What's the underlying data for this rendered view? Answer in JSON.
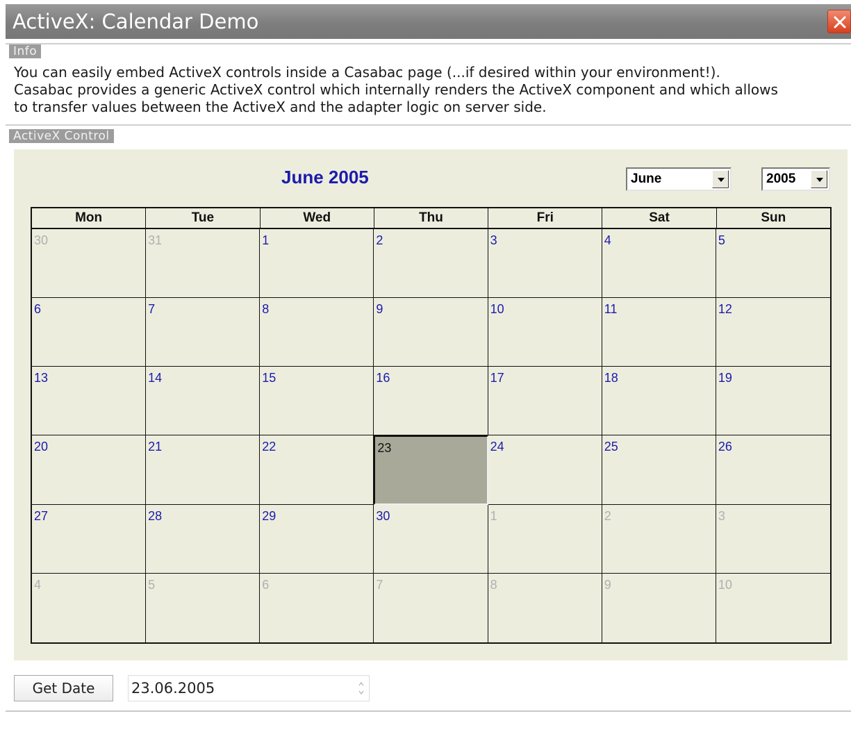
{
  "window": {
    "title": "ActiveX: Calendar Demo"
  },
  "info": {
    "label": "Info",
    "text": "You can easily embed ActiveX controls inside a Casabac page (...if desired within your environment!).\nCasabac provides a generic ActiveX control which internally renders the ActiveX component and which allows\nto transfer values between the ActiveX and the adapter logic on server side."
  },
  "activex": {
    "label": "ActiveX Control",
    "calendar": {
      "title": "June 2005",
      "month_select": "June",
      "year_select": "2005",
      "weekdays": [
        "Mon",
        "Tue",
        "Wed",
        "Thu",
        "Fri",
        "Sat",
        "Sun"
      ],
      "days": [
        {
          "d": "30",
          "other": true
        },
        {
          "d": "31",
          "other": true
        },
        {
          "d": "1"
        },
        {
          "d": "2"
        },
        {
          "d": "3"
        },
        {
          "d": "4"
        },
        {
          "d": "5"
        },
        {
          "d": "6"
        },
        {
          "d": "7"
        },
        {
          "d": "8"
        },
        {
          "d": "9"
        },
        {
          "d": "10"
        },
        {
          "d": "11"
        },
        {
          "d": "12"
        },
        {
          "d": "13"
        },
        {
          "d": "14"
        },
        {
          "d": "15"
        },
        {
          "d": "16"
        },
        {
          "d": "17"
        },
        {
          "d": "18"
        },
        {
          "d": "19"
        },
        {
          "d": "20"
        },
        {
          "d": "21"
        },
        {
          "d": "22"
        },
        {
          "d": "23",
          "selected": true
        },
        {
          "d": "24"
        },
        {
          "d": "25"
        },
        {
          "d": "26"
        },
        {
          "d": "27"
        },
        {
          "d": "28"
        },
        {
          "d": "29"
        },
        {
          "d": "30"
        },
        {
          "d": "1",
          "other": true
        },
        {
          "d": "2",
          "other": true
        },
        {
          "d": "3",
          "other": true
        },
        {
          "d": "4",
          "other": true
        },
        {
          "d": "5",
          "other": true
        },
        {
          "d": "6",
          "other": true
        },
        {
          "d": "7",
          "other": true
        },
        {
          "d": "8",
          "other": true
        },
        {
          "d": "9",
          "other": true
        },
        {
          "d": "10",
          "other": true
        }
      ]
    }
  },
  "actions": {
    "get_date_label": "Get Date",
    "date_value": "23.06.2005"
  },
  "colors": {
    "accent_blue": "#1b1bae",
    "selected_day_bg": "#a9a99a",
    "panel_bg": "#ededde",
    "close_red": "#d8401f"
  }
}
